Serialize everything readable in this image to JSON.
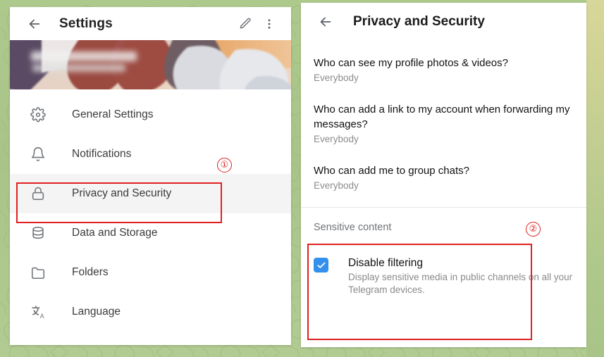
{
  "background": {
    "name": "telegram-green-doodle-wallpaper",
    "base_color": "#a9c488",
    "strip_color": "#d8d79a"
  },
  "left_panel": {
    "header": {
      "title": "Settings",
      "back_icon": "arrow-left-icon",
      "edit_icon": "pencil-icon",
      "menu_icon": "more-vertical-icon"
    },
    "banner": {
      "name": "profile-cover-photo",
      "description": "blurred anime profile cover image with obscured name text"
    },
    "menu": [
      {
        "label": "General Settings",
        "icon": "gear-icon",
        "active": false
      },
      {
        "label": "Notifications",
        "icon": "bell-icon",
        "active": false
      },
      {
        "label": "Privacy and Security",
        "icon": "lock-icon",
        "active": true
      },
      {
        "label": "Data and Storage",
        "icon": "database-icon",
        "active": false
      },
      {
        "label": "Folders",
        "icon": "folder-icon",
        "active": false
      },
      {
        "label": "Language",
        "icon": "translate-icon",
        "active": false
      }
    ]
  },
  "right_panel": {
    "header": {
      "title": "Privacy and Security",
      "back_icon": "arrow-left-icon"
    },
    "privacy_rows": [
      {
        "question": "Who can see my profile photos & videos?",
        "value": "Everybody"
      },
      {
        "question": "Who can add a link to my account when forwarding my messages?",
        "value": "Everybody"
      },
      {
        "question": "Who can add me to group chats?",
        "value": "Everybody"
      }
    ],
    "sensitive_content": {
      "section_title": "Sensitive content",
      "checkbox": {
        "label": "Disable filtering",
        "description": "Display sensitive media in public channels on all your Telegram devices.",
        "checked": true,
        "accent_color": "#3390ec",
        "check_icon": "check-icon"
      }
    }
  },
  "annotations": {
    "color": "#e02020",
    "markers": [
      {
        "label": "①",
        "target": "privacy-and-security-menu-item"
      },
      {
        "label": "②",
        "target": "sensitive-content-section"
      }
    ],
    "highlight_boxes": [
      {
        "name": "highlight-privacy-menu-item"
      },
      {
        "name": "highlight-sensitive-content"
      }
    ]
  }
}
